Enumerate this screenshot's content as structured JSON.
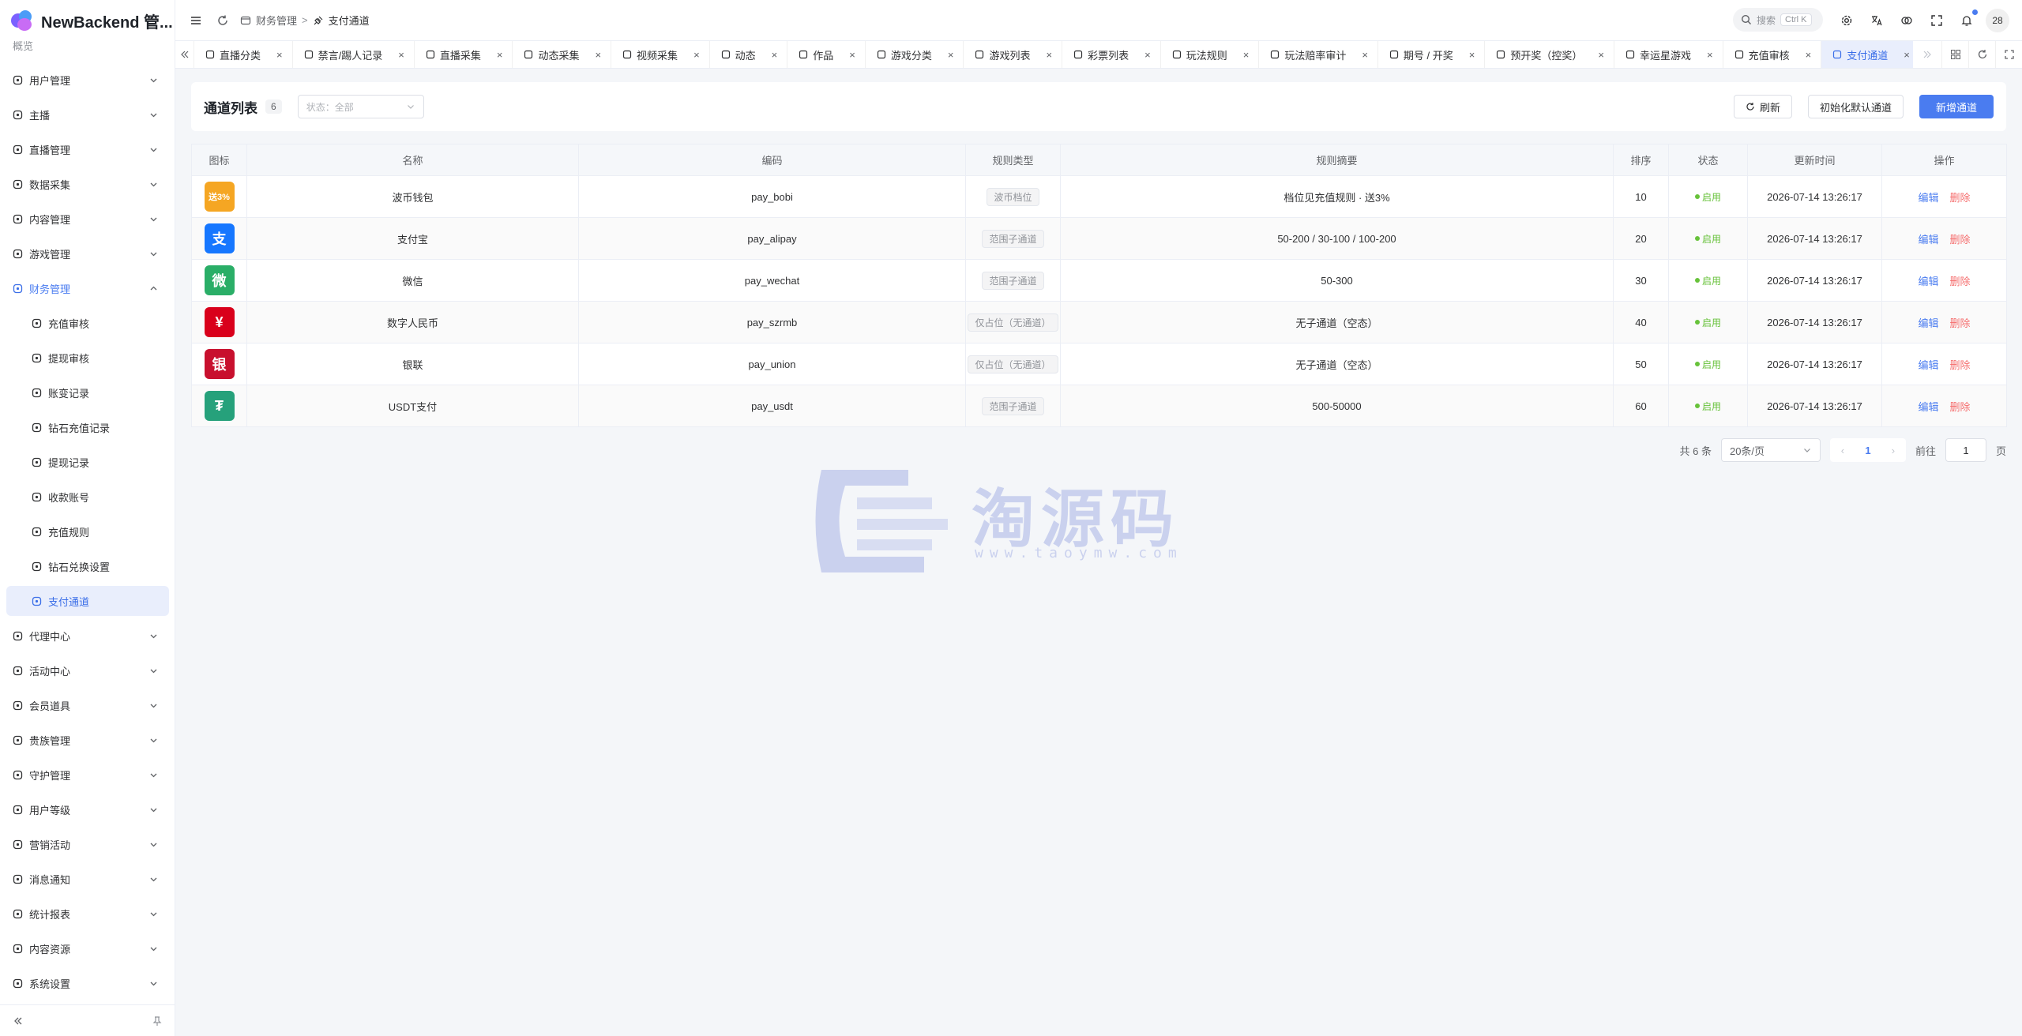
{
  "app": {
    "title": "NewBackend 管..."
  },
  "header": {
    "breadcrumb": [
      "财务管理",
      "支付通道"
    ],
    "search_label": "搜索",
    "search_shortcut": "Ctrl K",
    "avatar_text": "28"
  },
  "sidebar": {
    "partial_top": "概览",
    "items": [
      {
        "label": "用户管理",
        "icon": "user-icon"
      },
      {
        "label": "主播",
        "icon": "mic-icon"
      },
      {
        "label": "直播管理",
        "icon": "broadcast-icon"
      },
      {
        "label": "数据采集",
        "icon": "database-icon"
      },
      {
        "label": "内容管理",
        "icon": "content-icon"
      },
      {
        "label": "游戏管理",
        "icon": "gamepad-icon"
      },
      {
        "label": "财务管理",
        "icon": "wallet-icon"
      },
      {
        "label": "充值审核",
        "icon": "plus-circle-icon"
      },
      {
        "label": "提现审核",
        "icon": "minus-circle-icon"
      },
      {
        "label": "账变记录",
        "icon": "ledger-icon"
      },
      {
        "label": "钻石充值记录",
        "icon": "card-icon"
      },
      {
        "label": "提现记录",
        "icon": "cash-icon"
      },
      {
        "label": "收款账号",
        "icon": "account-icon"
      },
      {
        "label": "充值规则",
        "icon": "rules-icon"
      },
      {
        "label": "钻石兑换设置",
        "icon": "diamond-icon"
      },
      {
        "label": "支付通道",
        "icon": "plug-icon"
      },
      {
        "label": "代理中心",
        "icon": "agent-icon"
      },
      {
        "label": "活动中心",
        "icon": "sparkle-icon"
      },
      {
        "label": "会员道具",
        "icon": "gem-icon"
      },
      {
        "label": "贵族管理",
        "icon": "crown-icon"
      },
      {
        "label": "守护管理",
        "icon": "shield-icon"
      },
      {
        "label": "用户等级",
        "icon": "trend-icon"
      },
      {
        "label": "营销活动",
        "icon": "megaphone-icon"
      },
      {
        "label": "消息通知",
        "icon": "message-icon"
      },
      {
        "label": "统计报表",
        "icon": "bar-chart-icon"
      },
      {
        "label": "内容资源",
        "icon": "resource-icon"
      },
      {
        "label": "系统设置",
        "icon": "gear-icon"
      }
    ]
  },
  "tabs": [
    {
      "label": "直播分类"
    },
    {
      "label": "禁言/踢人记录"
    },
    {
      "label": "直播采集"
    },
    {
      "label": "动态采集"
    },
    {
      "label": "视频采集"
    },
    {
      "label": "动态"
    },
    {
      "label": "作品"
    },
    {
      "label": "游戏分类"
    },
    {
      "label": "游戏列表"
    },
    {
      "label": "彩票列表"
    },
    {
      "label": "玩法规则"
    },
    {
      "label": "玩法赔率审计"
    },
    {
      "label": "期号 / 开奖"
    },
    {
      "label": "预开奖（控奖）"
    },
    {
      "label": "幸运星游戏"
    },
    {
      "label": "充值审核"
    },
    {
      "label": "支付通道"
    }
  ],
  "card": {
    "title": "通道列表",
    "count": "6",
    "status_filter": "状态：全部",
    "refresh_label": "刷新",
    "init_label": "初始化默认通道",
    "add_label": "新增通道"
  },
  "table": {
    "columns": [
      "图标",
      "名称",
      "编码",
      "规则类型",
      "规则摘要",
      "排序",
      "状态",
      "更新时间",
      "操作"
    ],
    "edit_label": "编辑",
    "delete_label": "删除",
    "rows": [
      {
        "icon_text": "送3%",
        "icon_color": "#f5a623",
        "name": "波币钱包",
        "code": "pay_bobi",
        "type": "波币档位",
        "summary": "档位见充值规则 · 送3%",
        "sort": "10",
        "status": "启用",
        "updated": "2026-07-14 13:26:17"
      },
      {
        "icon_text": "支",
        "icon_color": "#1677ff",
        "name": "支付宝",
        "code": "pay_alipay",
        "type": "范围子通道",
        "summary": "50-200 / 30-100 / 100-200",
        "sort": "20",
        "status": "启用",
        "updated": "2026-07-14 13:26:17"
      },
      {
        "icon_text": "微",
        "icon_color": "#2aae67",
        "name": "微信",
        "code": "pay_wechat",
        "type": "范围子通道",
        "summary": "50-300",
        "sort": "30",
        "status": "启用",
        "updated": "2026-07-14 13:26:17"
      },
      {
        "icon_text": "¥",
        "icon_color": "#d9001b",
        "name": "数字人民币",
        "code": "pay_szrmb",
        "type": "仅占位（无通道）",
        "summary": "无子通道（空态）",
        "sort": "40",
        "status": "启用",
        "updated": "2026-07-14 13:26:17"
      },
      {
        "icon_text": "银",
        "icon_color": "#c8102e",
        "name": "银联",
        "code": "pay_union",
        "type": "仅占位（无通道）",
        "summary": "无子通道（空态）",
        "sort": "50",
        "status": "启用",
        "updated": "2026-07-14 13:26:17"
      },
      {
        "icon_text": "₮",
        "icon_color": "#26a17b",
        "name": "USDT支付",
        "code": "pay_usdt",
        "type": "范围子通道",
        "summary": "500-50000",
        "sort": "60",
        "status": "启用",
        "updated": "2026-07-14 13:26:17"
      }
    ]
  },
  "pagination": {
    "total": "共 6 条",
    "page_size": "20条/页",
    "current": "1",
    "goto_label": "前往",
    "goto_value": "1",
    "page_suffix": "页"
  },
  "watermark": {
    "text": "淘源码",
    "url": "www.taoymw.com"
  },
  "colors": {
    "accent": "#4a7cf0",
    "success": "#67c23a",
    "danger": "#f56c6c"
  }
}
